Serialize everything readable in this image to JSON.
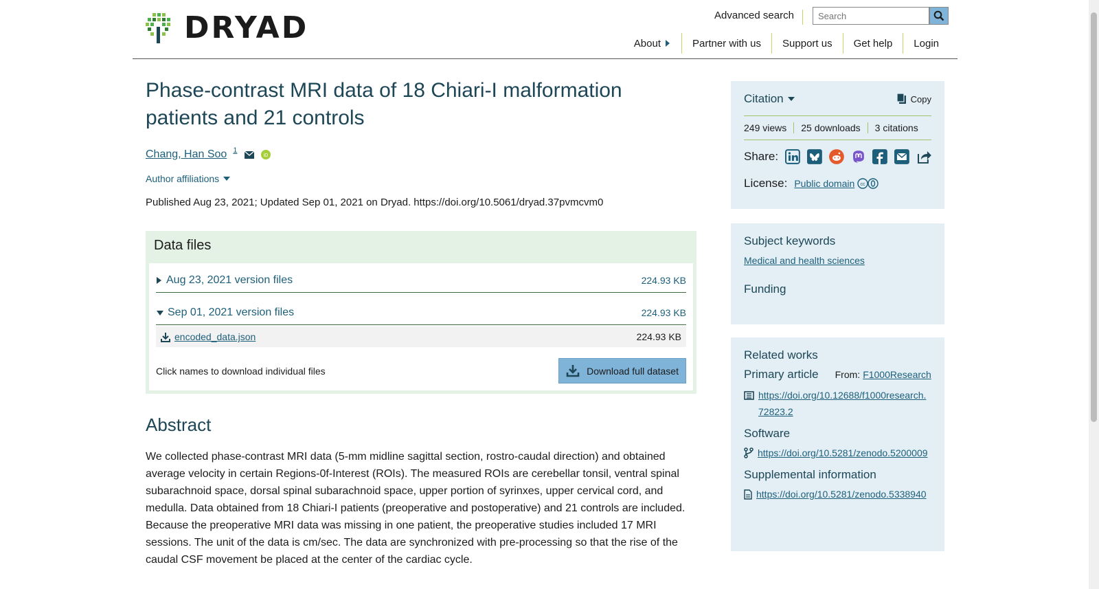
{
  "header": {
    "logo_text": "DRYAD",
    "advanced_search": "Advanced search",
    "search_placeholder": "Search",
    "nav": [
      "About",
      "Partner with us",
      "Support us",
      "Get help",
      "Login"
    ]
  },
  "main": {
    "title": "Phase-contrast MRI data of 18 Chiari-I malformation patients and 21 controls",
    "author": "Chang, Han Soo",
    "author_sup": "1",
    "affiliations_label": "Author affiliations",
    "published": "Published Aug 23, 2021; Updated Sep 01, 2021 on Dryad. https://doi.org/10.5061/dryad.37pvmcvm0",
    "data_files": {
      "heading": "Data files",
      "versions": [
        {
          "label": "Aug 23, 2021 version files",
          "size": "224.93 KB",
          "expanded": false
        },
        {
          "label": "Sep 01, 2021 version files",
          "size": "224.93 KB",
          "expanded": true
        }
      ],
      "file": {
        "name": "encoded_data.json",
        "size": "224.93 KB"
      },
      "hint": "Click names to download individual files",
      "download_button": "Download full dataset"
    },
    "abstract": {
      "heading": "Abstract",
      "text": "We collected phase-contrast MRI data (5-mm midline sagittal section, rostro-caudal direction) and obtained average velocity in certain Regions-0f-Interest (ROIs). The measured ROIs are cerebellar tonsil, ventral spinal subarachnoid space, dorsal spinal subarachnoid space, upper portion of syrinxes, upper cervical cord, and medulla. Data obtained from 18 Chiari-I patients (preoperative and postoperative) and 21 controls are included. Because the preoperative MRI data was missing in one patient, the preoperative studies included 17 MRI sessions. The unit of the data is cm/sec. The data are synchronized with pre-processing so that the rise of the caudal CSF movement be placed at the center of the cardiac cycle."
    }
  },
  "sidebar": {
    "citation": {
      "heading": "Citation",
      "copy_label": "Copy",
      "views": "249 views",
      "downloads": "25 downloads",
      "citations": "3 citations",
      "share_label": "Share:",
      "share_icons": [
        "linkedin-icon",
        "bluesky-icon",
        "reddit-icon",
        "mastodon-icon",
        "facebook-icon",
        "email-icon",
        "share-icon"
      ],
      "license_label": "License:",
      "license_value": "Public domain"
    },
    "keywords": {
      "heading": "Subject keywords",
      "keyword": "Medical and health sciences",
      "funding": "Funding"
    },
    "related": {
      "heading": "Related works",
      "primary_label": "Primary article",
      "from_label": "From:",
      "from_value": "F1000Research",
      "primary_link": "https://doi.org/10.12688/f1000research.72823.2",
      "software_label": "Software",
      "software_link": "https://doi.org/10.5281/zenodo.5200009",
      "supplemental_label": "Supplemental information",
      "supplemental_link": "https://doi.org/10.5281/zenodo.5338940"
    }
  },
  "colors": {
    "accent_blue": "#1d5f7a",
    "title_blue": "#1d4656",
    "button_blue": "#7fb3d8",
    "panel_blue": "#e3eff5",
    "panel_green": "#e4f1e5",
    "divider_green": "#9fc26a"
  }
}
